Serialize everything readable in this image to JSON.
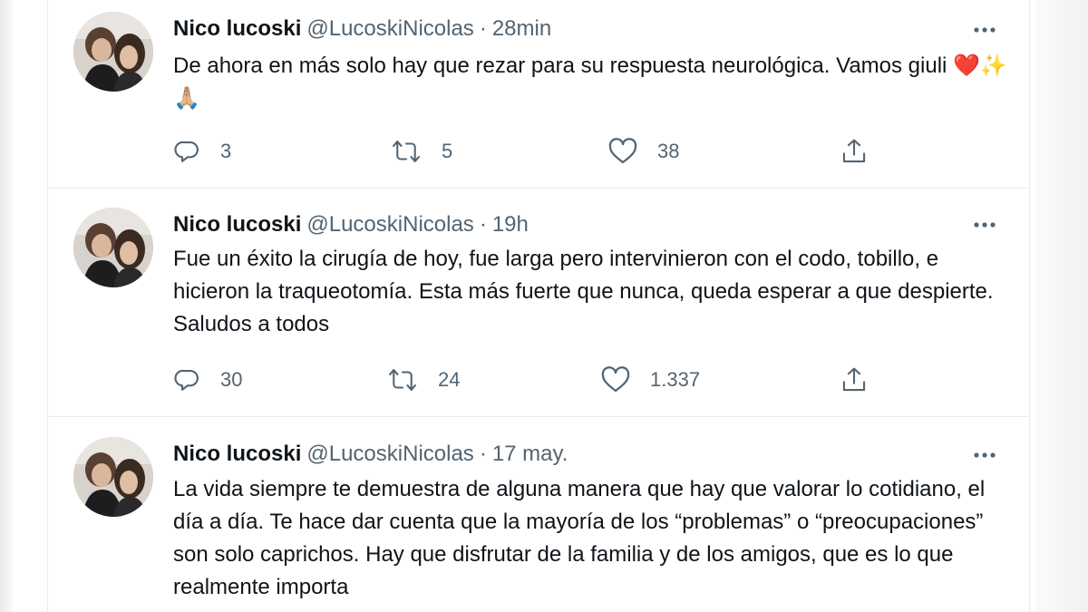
{
  "tweets": [
    {
      "name": "Nico lucoski",
      "handle": "@LucoskiNicolas",
      "separator": "·",
      "time": "28min",
      "text": "De ahora en más solo hay que rezar para su respuesta neurológica. Vamos giuli ❤️✨🙏🏼",
      "replies": "3",
      "retweets": "5",
      "likes": "38"
    },
    {
      "name": "Nico lucoski",
      "handle": "@LucoskiNicolas",
      "separator": "·",
      "time": "19h",
      "text": "Fue un éxito la cirugía de hoy, fue larga pero intervinieron con el codo, tobillo, e hicieron la traqueotomía. Esta más fuerte que nunca, queda esperar a que despierte. Saludos a todos",
      "replies": "30",
      "retweets": "24",
      "likes": "1.337"
    },
    {
      "name": "Nico lucoski",
      "handle": "@LucoskiNicolas",
      "separator": "·",
      "time": "17 may.",
      "text": "La vida siempre te demuestra de alguna manera que hay que valorar lo cotidiano, el día a día. Te hace dar cuenta que la mayoría de los “problemas” o “preocupaciones” son solo caprichos. Hay que disfrutar  de la familia y de los amigos, que es lo que realmente importa"
    }
  ],
  "icons": {
    "reply": "reply-icon",
    "retweet": "retweet-icon",
    "like": "heart-icon",
    "share": "share-icon",
    "more": "more-icon"
  },
  "colors": {
    "text": "#0f1419",
    "secondary": "#536471",
    "border": "#e6ecf0"
  }
}
